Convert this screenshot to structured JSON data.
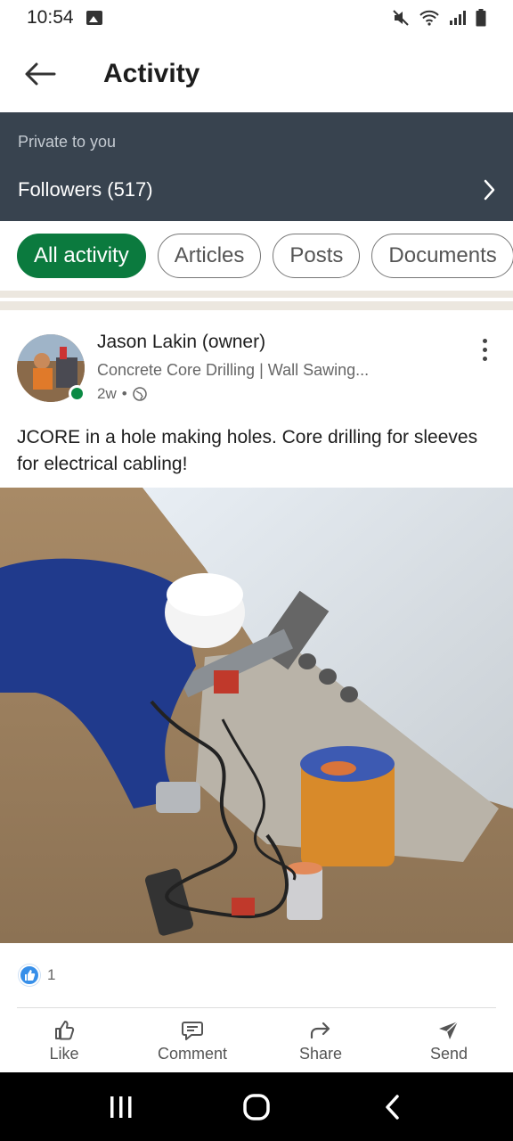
{
  "status_bar": {
    "time": "10:54"
  },
  "app_bar": {
    "title": "Activity"
  },
  "private_panel": {
    "label": "Private to you",
    "followers": "Followers (517)"
  },
  "filters": [
    {
      "label": "All activity",
      "active": true
    },
    {
      "label": "Articles",
      "active": false
    },
    {
      "label": "Posts",
      "active": false
    },
    {
      "label": "Documents",
      "active": false
    }
  ],
  "post": {
    "author": "Jason Lakin (owner)",
    "headline": "Concrete Core Drilling | Wall Sawing...",
    "time": "2w",
    "separator": "•",
    "text": "JCORE in a hole making holes. Core drilling for sleeves for electrical cabling!",
    "reaction_count": "1",
    "actions": {
      "like": "Like",
      "comment": "Comment",
      "share": "Share",
      "send": "Send"
    }
  },
  "colors": {
    "accent_green": "#0b7a3e",
    "panel": "#38434f",
    "like_blue": "#378fe9"
  }
}
